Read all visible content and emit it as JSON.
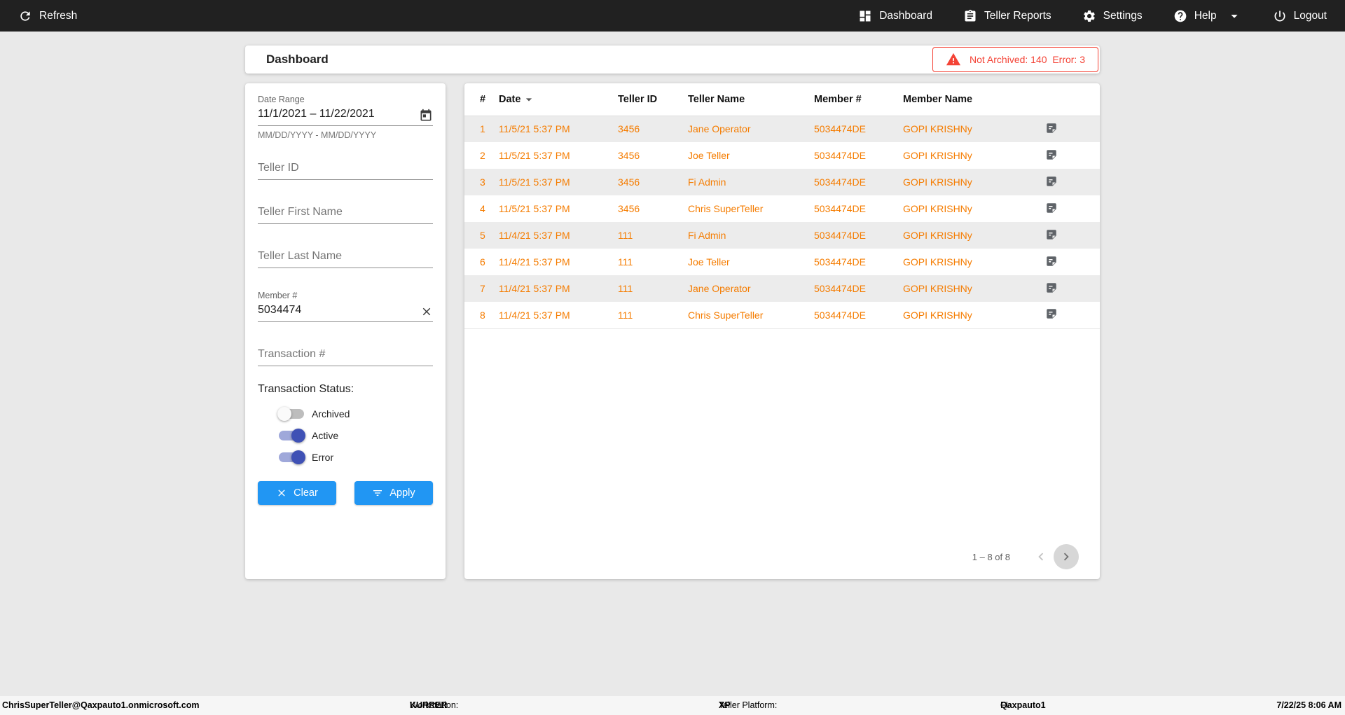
{
  "topbar": {
    "refresh": "Refresh",
    "dashboard": "Dashboard",
    "teller_reports": "Teller Reports",
    "settings": "Settings",
    "help": "Help",
    "logout": "Logout"
  },
  "header": {
    "title": "Dashboard",
    "alert_text": "Not Archived: 140  Error: 3"
  },
  "filters": {
    "date_range": {
      "label": "Date Range",
      "value": "11/1/2021 – 11/22/2021",
      "helper": "MM/DD/YYYY - MM/DD/YYYY"
    },
    "teller_id": {
      "placeholder": "Teller ID",
      "value": ""
    },
    "teller_first_name": {
      "placeholder": "Teller First Name",
      "value": ""
    },
    "teller_last_name": {
      "placeholder": "Teller Last Name",
      "value": ""
    },
    "member_number": {
      "label": "Member #",
      "value": "5034474"
    },
    "transaction_number": {
      "placeholder": "Transaction #",
      "value": ""
    },
    "status_label": "Transaction Status:",
    "status_toggles": [
      {
        "label": "Archived",
        "on": false
      },
      {
        "label": "Active",
        "on": true
      },
      {
        "label": "Error",
        "on": true
      }
    ],
    "clear_button": "Clear",
    "apply_button": "Apply"
  },
  "table": {
    "columns": [
      "#",
      "Date",
      "Teller ID",
      "Teller Name",
      "Member #",
      "Member Name"
    ],
    "sorted_column": "Date",
    "sort_direction": "desc",
    "rows": [
      {
        "num": "1",
        "date": "11/5/21 5:37 PM",
        "teller_id": "3456",
        "teller_name": "Jane Operator",
        "member_number": "5034474DE",
        "member_name": "GOPI KRISHNy"
      },
      {
        "num": "2",
        "date": "11/5/21 5:37 PM",
        "teller_id": "3456",
        "teller_name": "Joe Teller",
        "member_number": "5034474DE",
        "member_name": "GOPI KRISHNy"
      },
      {
        "num": "3",
        "date": "11/5/21 5:37 PM",
        "teller_id": "3456",
        "teller_name": "Fi Admin",
        "member_number": "5034474DE",
        "member_name": "GOPI KRISHNy"
      },
      {
        "num": "4",
        "date": "11/5/21 5:37 PM",
        "teller_id": "3456",
        "teller_name": "Chris SuperTeller",
        "member_number": "5034474DE",
        "member_name": "GOPI KRISHNy"
      },
      {
        "num": "5",
        "date": "11/4/21 5:37 PM",
        "teller_id": "111",
        "teller_name": "Fi Admin",
        "member_number": "5034474DE",
        "member_name": "GOPI KRISHNy"
      },
      {
        "num": "6",
        "date": "11/4/21 5:37 PM",
        "teller_id": "111",
        "teller_name": "Joe Teller",
        "member_number": "5034474DE",
        "member_name": "GOPI KRISHNy"
      },
      {
        "num": "7",
        "date": "11/4/21 5:37 PM",
        "teller_id": "111",
        "teller_name": "Jane Operator",
        "member_number": "5034474DE",
        "member_name": "GOPI KRISHNy"
      },
      {
        "num": "8",
        "date": "11/4/21 5:37 PM",
        "teller_id": "111",
        "teller_name": "Chris SuperTeller",
        "member_number": "5034474DE",
        "member_name": "GOPI KRISHNy"
      }
    ],
    "pagination": {
      "range_label": "1 – 8 of 8"
    }
  },
  "footer": {
    "user": "ChrisSuperTeller@Qaxpauto1.onmicrosoft.com",
    "workstation_label": "Workstation:",
    "workstation": "KURRER",
    "platform_label": "Teller Platform:",
    "platform": "XP",
    "fi_label": "FI:",
    "fi": "Qaxpauto1",
    "datetime": "7/22/25 8:06 AM"
  },
  "colors": {
    "topbar_bg": "#212121",
    "accent_blue": "#2196f3",
    "toggle_blue": "#3f51b5",
    "row_text_orange": "#f57c00",
    "alert_red": "#f44336"
  }
}
